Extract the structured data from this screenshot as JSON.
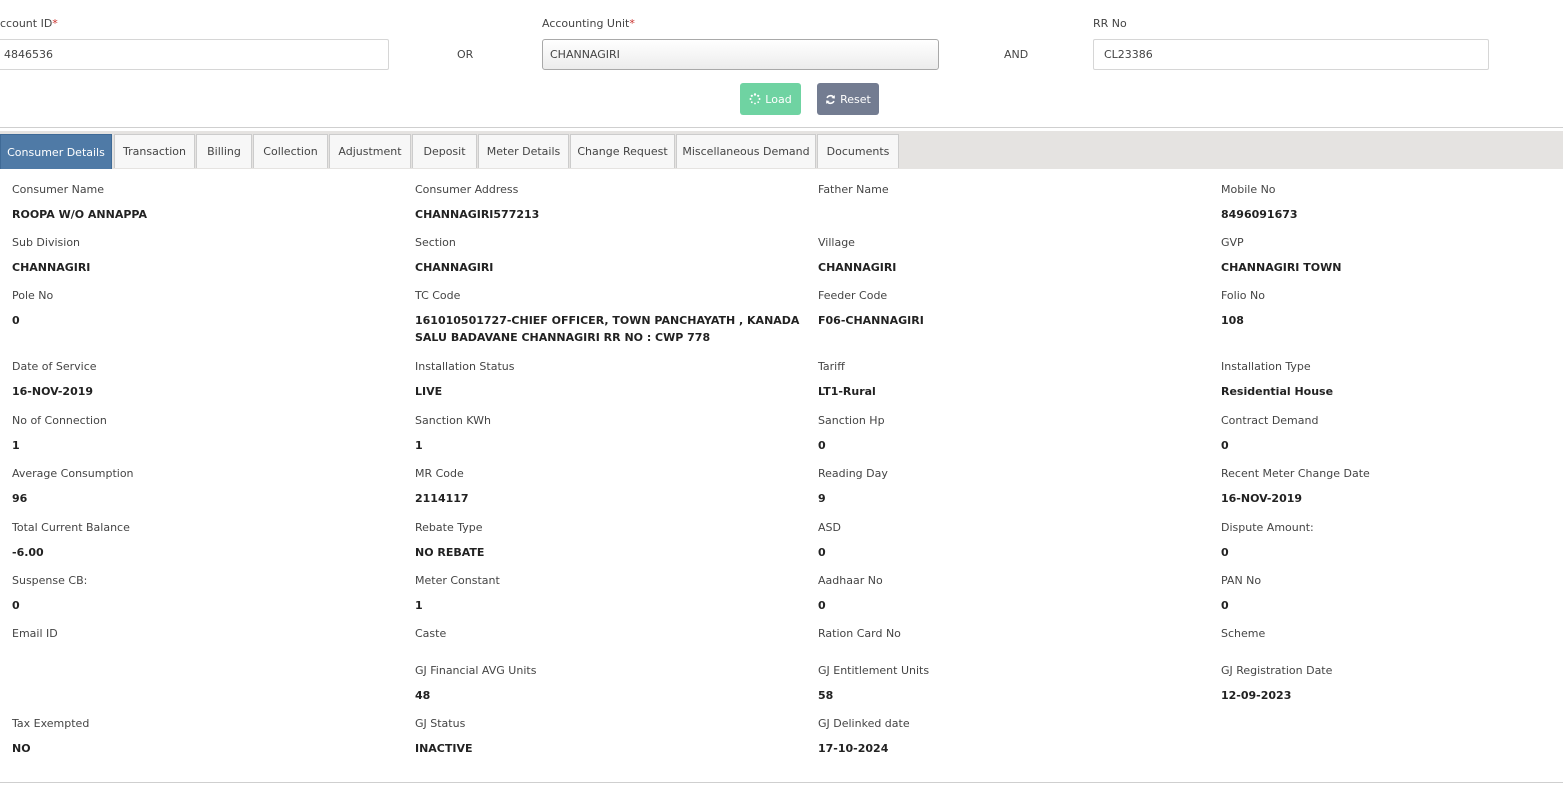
{
  "search": {
    "account_label": "ccount ID",
    "account_value": "4846536",
    "or_label": "OR",
    "unit_label": "Accounting Unit",
    "unit_value": "CHANNAGIRI",
    "and_label": "AND",
    "rr_label": "RR No",
    "rr_value": "CL23386",
    "required_mark": "*",
    "load_label": "Load",
    "reset_label": "Reset"
  },
  "tabs": [
    {
      "label": "Consumer Details",
      "active": true
    },
    {
      "label": "Transaction"
    },
    {
      "label": "Billing"
    },
    {
      "label": "Collection"
    },
    {
      "label": "Adjustment"
    },
    {
      "label": "Deposit"
    },
    {
      "label": "Meter Details"
    },
    {
      "label": "Change Request"
    },
    {
      "label": "Miscellaneous Demand"
    },
    {
      "label": "Documents"
    }
  ],
  "details": {
    "r1": [
      {
        "label": "Consumer Name",
        "value": "ROOPA W/O ANNAPPA"
      },
      {
        "label": "Consumer Address",
        "value": "CHANNAGIRI577213"
      },
      {
        "label": "Father Name",
        "value": ""
      },
      {
        "label": "Mobile No",
        "value": "8496091673"
      }
    ],
    "r2": [
      {
        "label": "Sub Division",
        "value": "CHANNAGIRI"
      },
      {
        "label": "Section",
        "value": "CHANNAGIRI"
      },
      {
        "label": "Village",
        "value": "CHANNAGIRI"
      },
      {
        "label": "GVP",
        "value": "CHANNAGIRI TOWN"
      }
    ],
    "r3": [
      {
        "label": "Pole No",
        "value": "0"
      },
      {
        "label": "TC Code",
        "value": "161010501727-CHIEF OFFICER, TOWN PANCHAYATH , KANADASALU BADAVANE CHANNAGIRI RR NO : CWP 778"
      },
      {
        "label": "Feeder Code",
        "value": "F06-CHANNAGIRI"
      },
      {
        "label": "Folio No",
        "value": "108"
      }
    ],
    "r4": [
      {
        "label": "Date of Service",
        "value": "16-NOV-2019"
      },
      {
        "label": "Installation Status",
        "value": "LIVE"
      },
      {
        "label": "Tariff",
        "value": "LT1-Rural"
      },
      {
        "label": "Installation Type",
        "value": "Residential House"
      }
    ],
    "r5": [
      {
        "label": "No of Connection",
        "value": "1"
      },
      {
        "label": "Sanction KWh",
        "value": "1"
      },
      {
        "label": "Sanction Hp",
        "value": "0"
      },
      {
        "label": "Contract Demand",
        "value": "0"
      }
    ],
    "r6": [
      {
        "label": "Average Consumption",
        "value": "96"
      },
      {
        "label": "MR Code",
        "value": "2114117"
      },
      {
        "label": "Reading Day",
        "value": "9"
      },
      {
        "label": "Recent Meter Change Date",
        "value": "16-NOV-2019"
      }
    ],
    "r7": [
      {
        "label": "Total Current Balance",
        "value": "-6.00"
      },
      {
        "label": "Rebate Type",
        "value": "NO REBATE"
      },
      {
        "label": "ASD",
        "value": "0"
      },
      {
        "label": "Dispute Amount:",
        "value": "0"
      }
    ],
    "r8": [
      {
        "label": "Suspense CB:",
        "value": "0"
      },
      {
        "label": "Meter Constant",
        "value": "1"
      },
      {
        "label": "Aadhaar No",
        "value": "0"
      },
      {
        "label": "PAN No",
        "value": "0"
      }
    ],
    "r9": [
      {
        "label": "Email ID",
        "value": ""
      },
      {
        "label": "Caste",
        "value": ""
      },
      {
        "label": "Ration Card No",
        "value": ""
      },
      {
        "label": "Scheme",
        "value": ""
      }
    ],
    "r10": [
      {
        "label": "GJ Financial AVG Units",
        "value": "48"
      },
      {
        "label": "GJ Entitlement Units",
        "value": "58"
      },
      {
        "label": "GJ Registration Date",
        "value": "12-09-2023"
      }
    ],
    "r11": [
      {
        "label": "Tax Exempted",
        "value": "NO"
      },
      {
        "label": "GJ Status",
        "value": "INACTIVE"
      },
      {
        "label": "GJ Delinked date",
        "value": "17-10-2024"
      }
    ]
  }
}
